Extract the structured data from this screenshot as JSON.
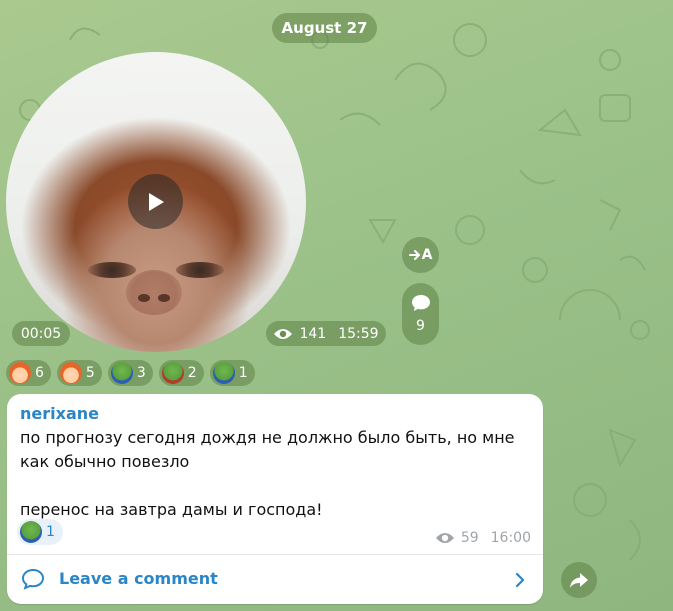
{
  "chat": {
    "date": "August 27"
  },
  "video_post": {
    "duration": "00:05",
    "views": "141",
    "time": "15:59",
    "translate_label": "A",
    "comment_count": "9",
    "reactions": [
      {
        "emoji": "girl-emoji",
        "count": "6"
      },
      {
        "emoji": "girl-emoji",
        "count": "5"
      },
      {
        "emoji": "pepe-emoji",
        "count": "3"
      },
      {
        "emoji": "pepe-red-emoji",
        "count": "2"
      },
      {
        "emoji": "pepe-emoji",
        "count": "1"
      }
    ]
  },
  "message": {
    "author": "nerixane",
    "line1": "по прогнозу сегодня дождя не должно было быть, но мне как обычно повезло",
    "line2": "перенос на завтра дамы и господа!",
    "reaction_count": "1",
    "views": "59",
    "time": "16:00",
    "comment_label": "Leave a comment"
  },
  "colors": {
    "accent": "#2a86c6",
    "pill_bg": "#6b8f4e",
    "background": "#9cc28a"
  }
}
